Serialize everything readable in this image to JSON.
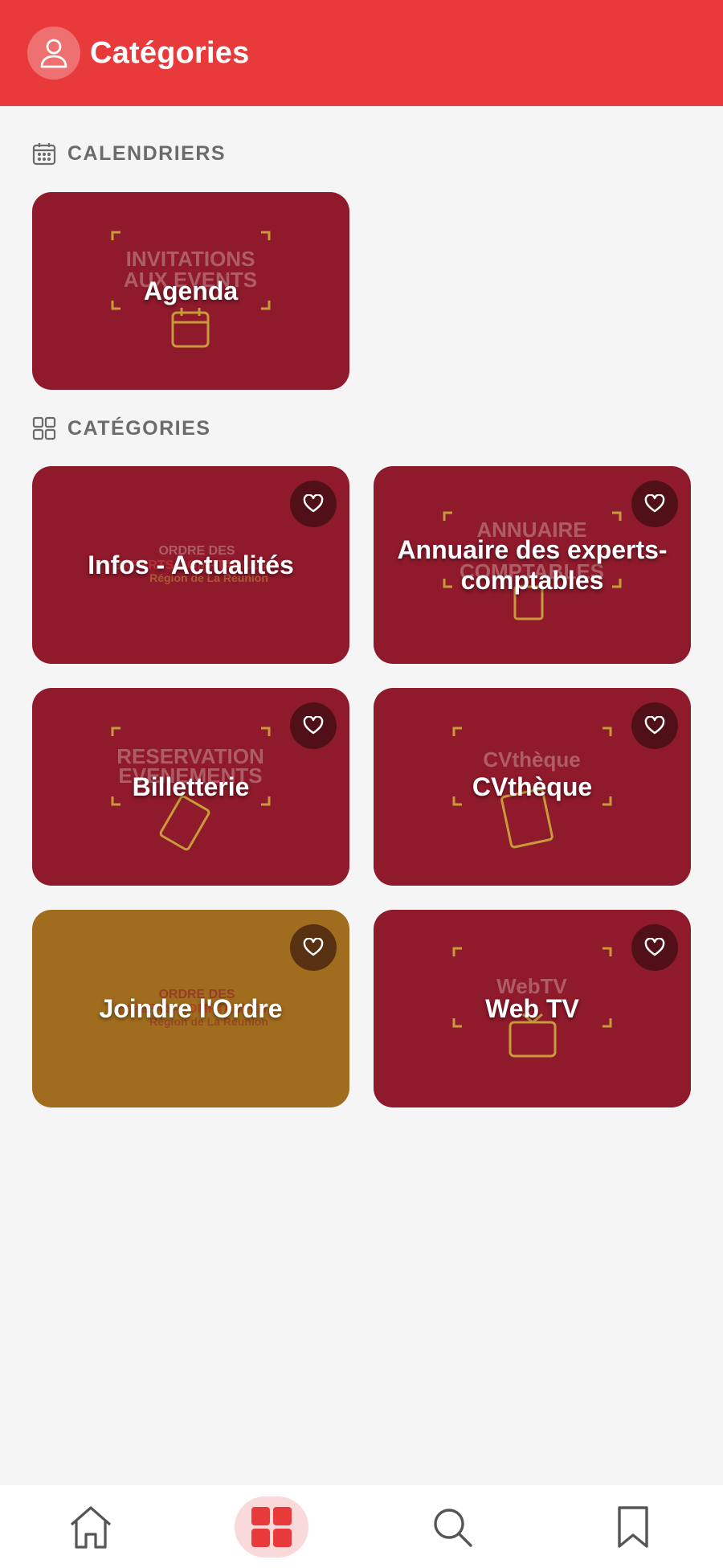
{
  "header": {
    "title": "Catégories",
    "accent": "#e83a3a"
  },
  "sections": {
    "calendars": {
      "label": "CALENDRIERS",
      "icon": "calendar-icon"
    },
    "categories": {
      "label": "CATÉGORIES",
      "icon": "grid-icon"
    }
  },
  "calendar_tiles": [
    {
      "title": "Agenda",
      "color": "#8e1a2b",
      "art_text": [
        "INVITATIONS",
        "AUX EVENTS"
      ]
    }
  ],
  "category_tiles": [
    {
      "title": "Infos - Actualités",
      "color": "#8e1a2b",
      "art_text": [
        "ORDRE DES",
        "EXPERTS-COMPTABLES",
        "Région de La Réunion"
      ]
    },
    {
      "title": "Annuaire des experts-comptables",
      "color": "#8e1a2b",
      "art_text": [
        "ANNUAIRE",
        "COMPTABLES"
      ]
    },
    {
      "title": "Billetterie",
      "color": "#8e1a2b",
      "art_text": [
        "RESERVATION",
        "EVENEMENTS"
      ]
    },
    {
      "title": "CVthèque",
      "color": "#8e1a2b",
      "art_text": [
        "CVthèque"
      ]
    },
    {
      "title": "Joindre l'Ordre",
      "color": "#a06c1e",
      "art_text": [
        "ORDRE DES",
        "EXPERTS-COMPTABLES",
        "Région de La Réunion"
      ]
    },
    {
      "title": "Web TV",
      "color": "#8e1a2b",
      "art_text": [
        "WebTV"
      ]
    }
  ],
  "tabbar": {
    "items": [
      {
        "icon": "home-icon"
      },
      {
        "icon": "categories-grid-icon",
        "active": true
      },
      {
        "icon": "search-icon"
      },
      {
        "icon": "bookmark-icon"
      }
    ]
  }
}
